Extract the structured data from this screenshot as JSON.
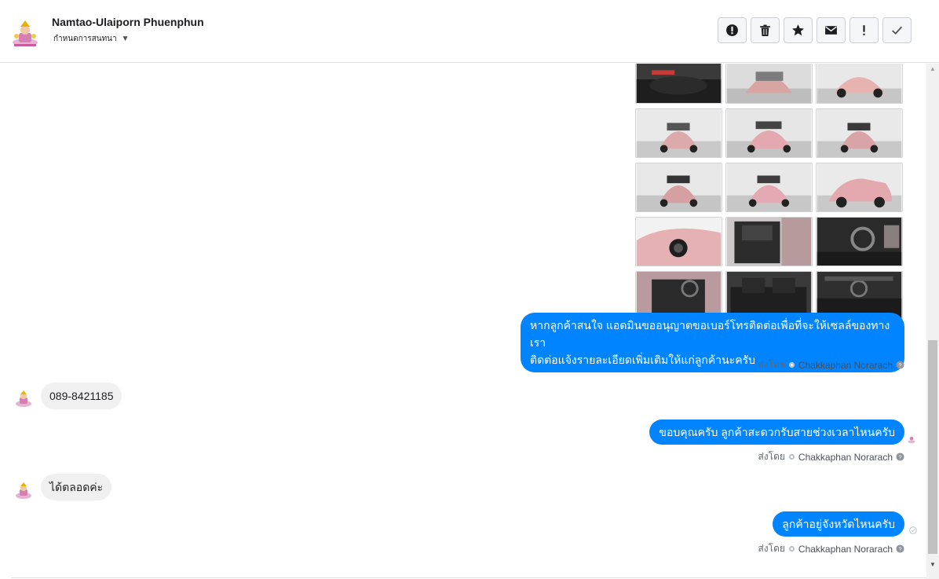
{
  "header": {
    "name": "Namtao-Ulaiporn Phuenphun",
    "assign_label": "กำหนดการสนทนา",
    "actions": [
      "report-icon",
      "delete-icon",
      "star-icon",
      "mail-icon",
      "exclamation-icon",
      "check-icon"
    ]
  },
  "photos": {
    "count": 15,
    "description_colors": [
      "pink car",
      "interior"
    ]
  },
  "messages": [
    {
      "from": "page",
      "text_line1": "หากลูกค้าสนใจ แอดมินขออนุญาตขอเบอร์โทรติดต่อเพื่อที่จะให้เซลล์ของทางเรา",
      "text_line2": "ติดต่อแจ้งรายละเอียดเพิ่มเติมให้แก่ลูกค้านะครับ"
    },
    {
      "from": "customer",
      "text": "089-8421185"
    },
    {
      "from": "page",
      "text": "ขอบคุณครับ ลูกค้าสะดวกรับสายช่วงเวลาไหนครับ"
    },
    {
      "from": "customer",
      "text": "ได้ตลอดค่ะ"
    },
    {
      "from": "page",
      "text": "ลูกค้าอยู่จังหวัดไหนครับ"
    }
  ],
  "sent_by": {
    "prefix": "ส่งโดย",
    "agent": "Chakkaphan Norarach"
  },
  "colors": {
    "accent": "#0084ff",
    "incoming_bubble": "#f1f0f0"
  }
}
